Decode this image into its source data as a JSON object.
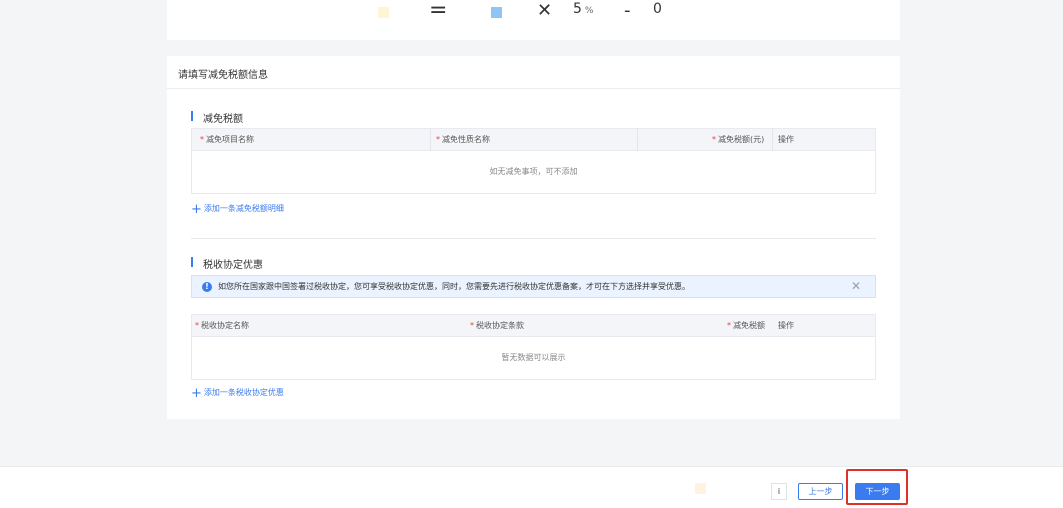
{
  "formula": {
    "equals": "=",
    "times": "✕",
    "rate": "5",
    "rate_unit": "%",
    "minus": "-",
    "result": "0",
    "colors": {
      "left_square": "#fff5d6",
      "right_square": "#8ec5f5"
    }
  },
  "card": {
    "title": "请填写减免税额信息",
    "reduction": {
      "section_title": "减免税额",
      "columns": [
        "减免项目名称",
        "减免性质名称",
        "减免税额(元)",
        "操作"
      ],
      "empty_text": "如无减免事项，可不添加",
      "add_link": "添加一条减免税额明细"
    },
    "treaty": {
      "section_title": "税收协定优惠",
      "alert_text": "如您所在国家跟中国签署过税收协定，您可享受税收协定优惠，同时，您需要先进行税收协定优惠备案，才可在下方选择并享受优惠。",
      "columns": [
        "税收协定名称",
        "税收协定条款",
        "减免税额",
        "操作"
      ],
      "empty_text": "暂无数据可以展示",
      "add_link": "添加一条税收协定优惠"
    }
  },
  "footer": {
    "info_label": "i",
    "prev_label": "上一步",
    "next_label": "下一步"
  },
  "colors": {
    "accent": "#3a7bf0",
    "required": "#e0473e",
    "highlight": "#e0302a"
  }
}
